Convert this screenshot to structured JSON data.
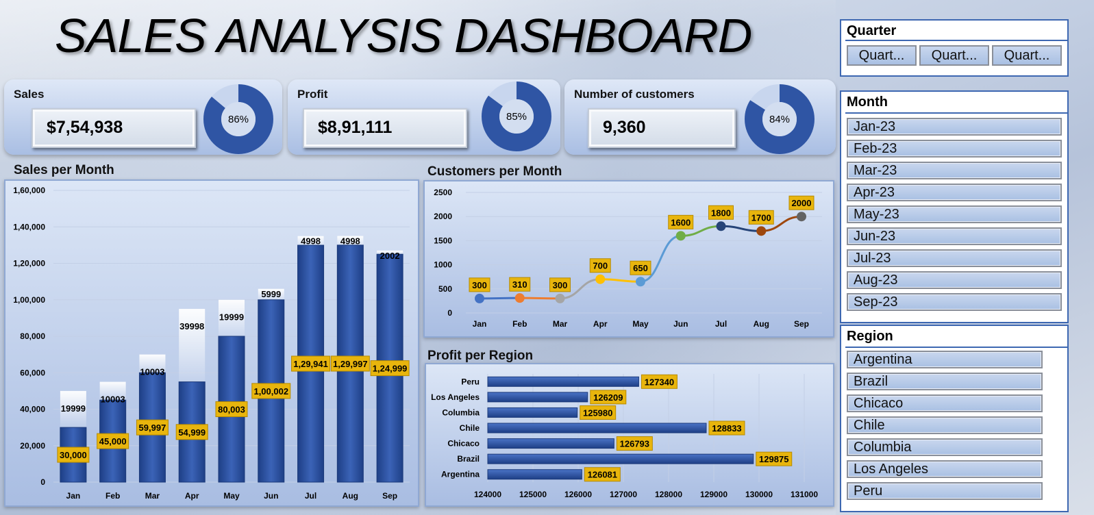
{
  "title": "SALES ANALYSIS DASHBOARD",
  "colors": {
    "bar": "#2f55a4",
    "label_bg": "#e8b50d",
    "donut": "#2f55a4",
    "donut_rest": "#c8d6ee"
  },
  "kpis": [
    {
      "label": "Sales",
      "value": "$7,54,938",
      "pct_label": "86%",
      "pct": 0.86
    },
    {
      "label": "Profit",
      "value": "$8,91,111",
      "pct_label": "85%",
      "pct": 0.85
    },
    {
      "label": "Number of customers",
      "value": "9,360",
      "pct_label": "84%",
      "pct": 0.84
    }
  ],
  "slicers": {
    "quarter": {
      "title": "Quarter",
      "items": [
        "Quart...",
        "Quart...",
        "Quart..."
      ]
    },
    "month": {
      "title": "Month",
      "items": [
        "Jan-23",
        "Feb-23",
        "Mar-23",
        "Apr-23",
        "May-23",
        "Jun-23",
        "Jul-23",
        "Aug-23",
        "Sep-23"
      ]
    },
    "region": {
      "title": "Region",
      "items": [
        "Argentina",
        "Brazil",
        "Chicaco",
        "Chile",
        "Columbia",
        "Los Angeles",
        "Peru"
      ]
    }
  },
  "chart_data": [
    {
      "type": "bar",
      "title": "Sales per Month",
      "categories": [
        "Jan",
        "Feb",
        "Mar",
        "Apr",
        "May",
        "Jun",
        "Jul",
        "Aug",
        "Sep"
      ],
      "series": [
        {
          "name": "",
          "values": [
            30000,
            45000,
            59997,
            54999,
            80003,
            100002,
            129941,
            129997,
            124999
          ],
          "labels": [
            "30,000",
            "45,000",
            "59,997",
            "54,999",
            "80,003",
            "1,00,002",
            "1,29,941",
            "1,29,997",
            "1,24,999"
          ]
        },
        {
          "name": "",
          "values": [
            19999,
            10003,
            10003,
            39998,
            19999,
            5999,
            4998,
            4998,
            2002
          ],
          "labels": [
            "19999",
            "10003",
            "10003",
            "39998",
            "19999",
            "5999",
            "4998",
            "4998",
            "2002"
          ]
        }
      ],
      "stacked": true,
      "ylim": [
        0,
        160000
      ],
      "yticks": [
        0,
        20000,
        40000,
        60000,
        80000,
        100000,
        120000,
        140000,
        160000
      ],
      "ytick_labels": [
        "0",
        "20,000",
        "40,000",
        "60,000",
        "80,000",
        "1,00,000",
        "1,20,000",
        "1,40,000",
        "1,60,000"
      ]
    },
    {
      "type": "line",
      "title": "Customers per Month",
      "categories": [
        "Jan",
        "Feb",
        "Mar",
        "Apr",
        "May",
        "Jun",
        "Jul",
        "Aug",
        "Sep"
      ],
      "values": [
        300,
        310,
        300,
        700,
        650,
        1600,
        1800,
        1700,
        2000
      ],
      "point_colors": [
        "#4472c4",
        "#ed7d31",
        "#a5a5a5",
        "#ffc000",
        "#5b9bd5",
        "#70ad47",
        "#264478",
        "#9e480e",
        "#636363"
      ],
      "ylim": [
        0,
        2500
      ],
      "yticks": [
        0,
        500,
        1000,
        1500,
        2000,
        2500
      ]
    },
    {
      "type": "bar",
      "orientation": "horizontal",
      "title": "Profit per Region",
      "categories": [
        "Peru",
        "Los Angeles",
        "Columbia",
        "Chile",
        "Chicaco",
        "Brazil",
        "Argentina"
      ],
      "values": [
        127340,
        126209,
        125980,
        128833,
        126793,
        129875,
        126081
      ],
      "xlim": [
        124000,
        131000
      ],
      "xticks": [
        124000,
        125000,
        126000,
        127000,
        128000,
        129000,
        130000,
        131000
      ]
    }
  ]
}
